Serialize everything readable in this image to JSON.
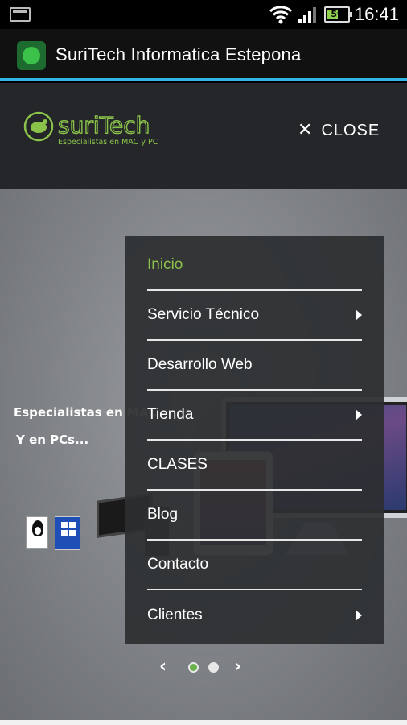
{
  "status_bar": {
    "battery_level": "59",
    "time": "16:41",
    "icons": [
      "screenshot-icon",
      "wifi-icon",
      "signal-icon",
      "battery-icon"
    ]
  },
  "app_bar": {
    "title": "SuriTech Informatica Estepona",
    "accent_color": "#33b5e5"
  },
  "site": {
    "logo_text": "suriTech",
    "logo_tagline": "Especialistas en MAC y PC",
    "close_label": "CLOSE",
    "hero_line1": "Especialistas en MAC",
    "hero_line2": "Y en PCs...",
    "badge_linux_text": "GNU/Linux",
    "badge_windows_text": "Windows 8",
    "brand_color": "#8bc34a"
  },
  "menu": {
    "items": [
      {
        "label": "Inicio",
        "active": true,
        "has_submenu": false
      },
      {
        "label": "Servicio Técnico",
        "active": false,
        "has_submenu": true
      },
      {
        "label": "Desarrollo Web",
        "active": false,
        "has_submenu": false
      },
      {
        "label": "Tienda",
        "active": false,
        "has_submenu": true
      },
      {
        "label": "CLASES",
        "active": false,
        "has_submenu": false
      },
      {
        "label": "Blog",
        "active": false,
        "has_submenu": false
      },
      {
        "label": "Contacto",
        "active": false,
        "has_submenu": false
      },
      {
        "label": "Clientes",
        "active": false,
        "has_submenu": true
      }
    ]
  },
  "carousel": {
    "slide_count": 2,
    "active_slide": 1
  }
}
